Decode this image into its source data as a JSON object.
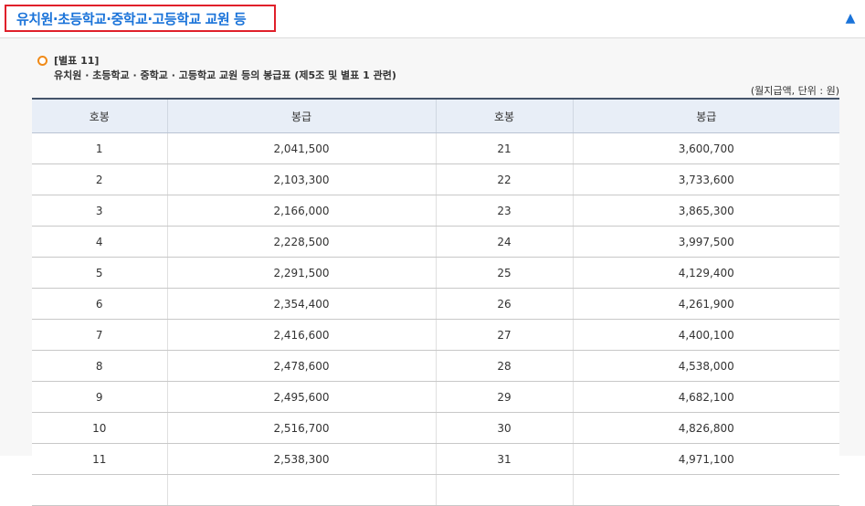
{
  "header": {
    "title": "유치원·초등학교·중학교·고등학교 교원 등",
    "collapse_icon": "▲"
  },
  "table_caption": {
    "label": "[별표 11]",
    "subtitle": "유치원 · 초등학교 · 중학교 · 고등학교 교원 등의 봉급표 (제5조 및 별표 1 관련)",
    "unit": "(월지급액, 단위 : 원)"
  },
  "table": {
    "columns": [
      "호봉",
      "봉급",
      "호봉",
      "봉급"
    ],
    "rows": [
      [
        "1",
        "2,041,500",
        "21",
        "3,600,700"
      ],
      [
        "2",
        "2,103,300",
        "22",
        "3,733,600"
      ],
      [
        "3",
        "2,166,000",
        "23",
        "3,865,300"
      ],
      [
        "4",
        "2,228,500",
        "24",
        "3,997,500"
      ],
      [
        "5",
        "2,291,500",
        "25",
        "4,129,400"
      ],
      [
        "6",
        "2,354,400",
        "26",
        "4,261,900"
      ],
      [
        "7",
        "2,416,600",
        "27",
        "4,400,100"
      ],
      [
        "8",
        "2,478,600",
        "28",
        "4,538,000"
      ],
      [
        "9",
        "2,495,600",
        "29",
        "4,682,100"
      ],
      [
        "10",
        "2,516,700",
        "30",
        "4,826,800"
      ],
      [
        "11",
        "2,538,300",
        "31",
        "4,971,100"
      ],
      [
        "",
        "",
        "",
        ""
      ]
    ]
  },
  "colors": {
    "title_text": "#1a73d9",
    "title_border": "#e0202a",
    "header_row_bg": "#e8eef7",
    "bullet": "#f08a18"
  }
}
